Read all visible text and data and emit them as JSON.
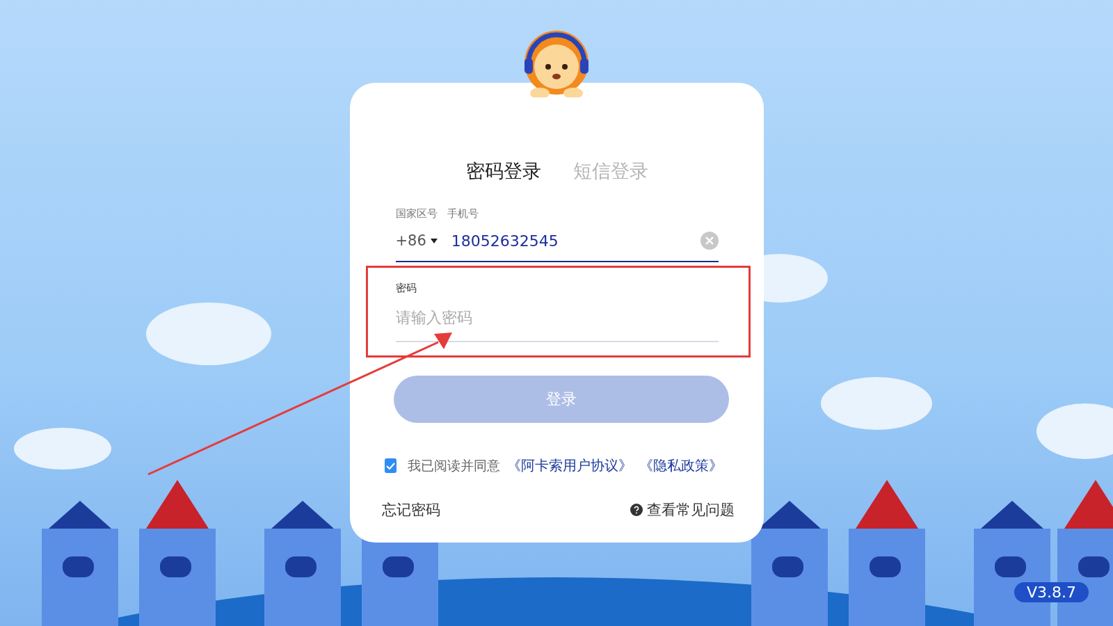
{
  "tabs": [
    {
      "label": "密码登录",
      "selected": true
    },
    {
      "label": "短信登录",
      "selected": false
    }
  ],
  "phone": {
    "country_label": "国家区号",
    "phone_label": "手机号",
    "country_code": "+86",
    "value": "18052632545"
  },
  "password": {
    "label": "密码",
    "placeholder": "请输入密码"
  },
  "login_button": {
    "label": "登录",
    "disabled": true
  },
  "agreement": {
    "checked": true,
    "text": "我已阅读并同意",
    "links": [
      "《阿卡索用户协议》",
      "《隐私政策》"
    ]
  },
  "forgot_link": "忘记密码",
  "help_link": "查看常见问题",
  "version": "V3.8.7"
}
